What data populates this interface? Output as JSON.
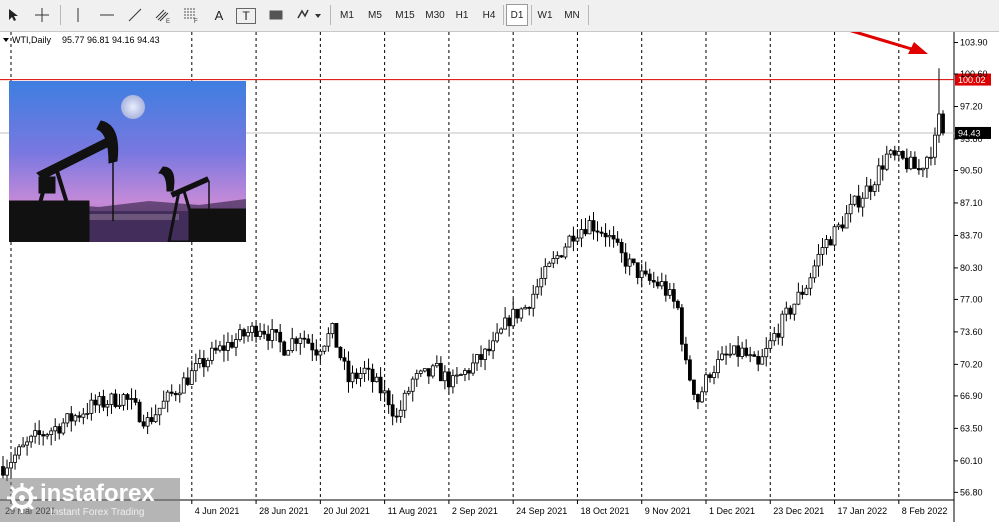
{
  "toolbar": {
    "tools": [
      {
        "name": "cursor-icon"
      },
      {
        "name": "crosshair-icon"
      },
      {
        "name": "vertical-line-icon"
      },
      {
        "name": "horizontal-line-icon"
      },
      {
        "name": "trendline-icon"
      },
      {
        "name": "equidistant-channel-icon"
      },
      {
        "name": "fibonacci-icon"
      },
      {
        "name": "text-icon",
        "label": "A"
      },
      {
        "name": "text-label-icon",
        "label": "T"
      },
      {
        "name": "rectangle-icon"
      },
      {
        "name": "shapes-dropdown-icon"
      }
    ],
    "timeframes": [
      "M1",
      "M5",
      "M15",
      "M30",
      "H1",
      "H4",
      "D1",
      "W1",
      "MN"
    ],
    "active_timeframe": "D1"
  },
  "chart_data": {
    "type": "candlestick",
    "title": "WTI,Daily",
    "ohlc_readout": "95.77 96.81 94.16 94.43",
    "ylim": [
      56.0,
      105.0
    ],
    "y_ticks": [
      "103.90",
      "100.60",
      "97.20",
      "93.80",
      "90.50",
      "87.10",
      "83.70",
      "80.30",
      "77.00",
      "73.60",
      "70.20",
      "66.90",
      "63.50",
      "60.10",
      "56.80"
    ],
    "x_labels": [
      {
        "label": "29 Mar 2021",
        "t": 0
      },
      {
        "label": "4 Jun 2021",
        "t": 47
      },
      {
        "label": "28 Jun 2021",
        "t": 63
      },
      {
        "label": "20 Jul 2021",
        "t": 79
      },
      {
        "label": "11 Aug 2021",
        "t": 95
      },
      {
        "label": "2 Sep 2021",
        "t": 111
      },
      {
        "label": "24 Sep 2021",
        "t": 127
      },
      {
        "label": "18 Oct 2021",
        "t": 143
      },
      {
        "label": "9 Nov 2021",
        "t": 159
      },
      {
        "label": "1 Dec 2021",
        "t": 175
      },
      {
        "label": "23 Dec 2021",
        "t": 191
      },
      {
        "label": "17 Jan 2022",
        "t": 207
      },
      {
        "label": "8 Feb 2022",
        "t": 223
      }
    ],
    "price_lines": [
      {
        "price": 100.02,
        "label": "100.02",
        "color": "#dd0000"
      },
      {
        "price": 94.43,
        "label": "94.43",
        "color": "#000000"
      }
    ],
    "anchors": [
      [
        0,
        59.5
      ],
      [
        8,
        62.5
      ],
      [
        14,
        63.8
      ],
      [
        22,
        65.8
      ],
      [
        30,
        66.8
      ],
      [
        36,
        64.2
      ],
      [
        44,
        68.0
      ],
      [
        52,
        71.2
      ],
      [
        58,
        72.8
      ],
      [
        64,
        74.2
      ],
      [
        70,
        72.0
      ],
      [
        74,
        73.4
      ],
      [
        78,
        71.8
      ],
      [
        82,
        73.6
      ],
      [
        86,
        68.5
      ],
      [
        90,
        69.5
      ],
      [
        96,
        66.5
      ],
      [
        98,
        64.5
      ],
      [
        102,
        68.5
      ],
      [
        108,
        69.5
      ],
      [
        112,
        68.2
      ],
      [
        118,
        70.5
      ],
      [
        122,
        72.0
      ],
      [
        126,
        75.0
      ],
      [
        130,
        76.2
      ],
      [
        134,
        79.0
      ],
      [
        138,
        81.5
      ],
      [
        142,
        84.0
      ],
      [
        146,
        85.0
      ],
      [
        150,
        84.0
      ],
      [
        154,
        81.5
      ],
      [
        160,
        79.0
      ],
      [
        164,
        78.5
      ],
      [
        168,
        76.0
      ],
      [
        170,
        70.0
      ],
      [
        173,
        66.5
      ],
      [
        176,
        69.5
      ],
      [
        180,
        71.0
      ],
      [
        184,
        71.5
      ],
      [
        188,
        69.8
      ],
      [
        192,
        73.2
      ],
      [
        196,
        76.0
      ],
      [
        200,
        78.5
      ],
      [
        204,
        82.5
      ],
      [
        208,
        84.5
      ],
      [
        212,
        87.0
      ],
      [
        216,
        89.0
      ],
      [
        220,
        92.0
      ],
      [
        224,
        91.5
      ],
      [
        228,
        90.5
      ],
      [
        232,
        93.5
      ],
      [
        233,
        95.8
      ],
      [
        234,
        94.4
      ]
    ],
    "spike": {
      "t": 233,
      "high": 101.2
    },
    "candle_count": 235
  },
  "watermark": {
    "brand": "instaforex",
    "tagline": "Instant Forex Trading"
  },
  "image": {
    "name": "oil-pumpjack-sunset-photo"
  }
}
